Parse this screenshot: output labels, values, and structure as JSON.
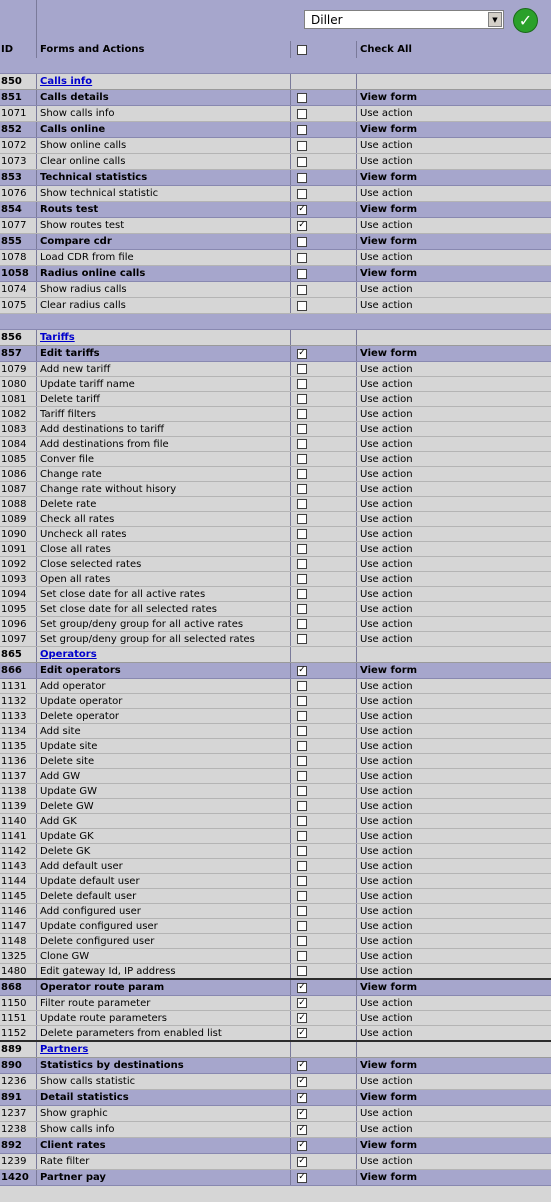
{
  "toolbar": {
    "role_value": "Diller"
  },
  "header": {
    "id_label": "ID",
    "forms_label": "Forms and Actions",
    "check_all_label": "Check All",
    "check_all_checked": false
  },
  "rows": [
    {
      "type": "space",
      "h": 16
    },
    {
      "type": "group",
      "id": "850",
      "name": "Calls info",
      "h": 16
    },
    {
      "type": "form",
      "id": "851",
      "name": "Calls details",
      "checked": false,
      "right": "View form",
      "h": 16
    },
    {
      "type": "action",
      "id": "1071",
      "name": "Show calls info",
      "checked": false,
      "right": "Use action",
      "h": 16
    },
    {
      "type": "form",
      "id": "852",
      "name": "Calls online",
      "checked": false,
      "right": "View form",
      "h": 16
    },
    {
      "type": "action",
      "id": "1072",
      "name": "Show online calls",
      "checked": false,
      "right": "Use action",
      "h": 16
    },
    {
      "type": "action",
      "id": "1073",
      "name": "Clear online calls",
      "checked": false,
      "right": "Use action",
      "h": 16
    },
    {
      "type": "form",
      "id": "853",
      "name": "Technical statistics",
      "checked": false,
      "right": "View form",
      "h": 16
    },
    {
      "type": "action",
      "id": "1076",
      "name": "Show technical statistic",
      "checked": false,
      "right": "Use action",
      "h": 16
    },
    {
      "type": "form",
      "id": "854",
      "name": "Routs test",
      "checked": true,
      "right": "View form",
      "h": 16
    },
    {
      "type": "action",
      "id": "1077",
      "name": "Show routes test",
      "checked": true,
      "right": "Use action",
      "h": 16
    },
    {
      "type": "form",
      "id": "855",
      "name": "Compare cdr",
      "checked": false,
      "right": "View form",
      "h": 16
    },
    {
      "type": "action",
      "id": "1078",
      "name": "Load CDR from file",
      "checked": false,
      "right": "Use action",
      "h": 16
    },
    {
      "type": "form",
      "id": "1058",
      "name": "Radius online calls",
      "checked": false,
      "right": "View form",
      "h": 16
    },
    {
      "type": "action",
      "id": "1074",
      "name": "Show radius calls",
      "checked": false,
      "right": "Use action",
      "h": 16
    },
    {
      "type": "action",
      "id": "1075",
      "name": "Clear radius calls",
      "checked": false,
      "right": "Use action",
      "h": 16
    },
    {
      "type": "space",
      "h": 16
    },
    {
      "type": "group",
      "id": "856",
      "name": "Tariffs",
      "h": 16
    },
    {
      "type": "form",
      "id": "857",
      "name": "Edit tariffs",
      "checked": true,
      "right": "View form",
      "h": 16
    },
    {
      "type": "action",
      "id": "1079",
      "name": "Add new tariff",
      "checked": false,
      "right": "Use action",
      "h": 15
    },
    {
      "type": "action",
      "id": "1080",
      "name": "Update tariff name",
      "checked": false,
      "right": "Use action",
      "h": 15
    },
    {
      "type": "action",
      "id": "1081",
      "name": "Delete tariff",
      "checked": false,
      "right": "Use action",
      "h": 15
    },
    {
      "type": "action",
      "id": "1082",
      "name": "Tariff filters",
      "checked": false,
      "right": "Use action",
      "h": 15
    },
    {
      "type": "action",
      "id": "1083",
      "name": "Add destinations to tariff",
      "checked": false,
      "right": "Use action",
      "h": 15
    },
    {
      "type": "action",
      "id": "1084",
      "name": "Add destinations from file",
      "checked": false,
      "right": "Use action",
      "h": 15
    },
    {
      "type": "action",
      "id": "1085",
      "name": "Conver file",
      "checked": false,
      "right": "Use action",
      "h": 15
    },
    {
      "type": "action",
      "id": "1086",
      "name": "Change rate",
      "checked": false,
      "right": "Use action",
      "h": 15
    },
    {
      "type": "action",
      "id": "1087",
      "name": "Change rate without hisory",
      "checked": false,
      "right": "Use action",
      "h": 15
    },
    {
      "type": "action",
      "id": "1088",
      "name": "Delete rate",
      "checked": false,
      "right": "Use action",
      "h": 15
    },
    {
      "type": "action",
      "id": "1089",
      "name": "Check all rates",
      "checked": false,
      "right": "Use action",
      "h": 15
    },
    {
      "type": "action",
      "id": "1090",
      "name": "Uncheck all rates",
      "checked": false,
      "right": "Use action",
      "h": 15
    },
    {
      "type": "action",
      "id": "1091",
      "name": "Close all rates",
      "checked": false,
      "right": "Use action",
      "h": 15
    },
    {
      "type": "action",
      "id": "1092",
      "name": "Close selected rates",
      "checked": false,
      "right": "Use action",
      "h": 15
    },
    {
      "type": "action",
      "id": "1093",
      "name": "Open all rates",
      "checked": false,
      "right": "Use action",
      "h": 15
    },
    {
      "type": "action",
      "id": "1094",
      "name": "Set close date for all active rates",
      "checked": false,
      "right": "Use action",
      "h": 15
    },
    {
      "type": "action",
      "id": "1095",
      "name": "Set close date for all selected rates",
      "checked": false,
      "right": "Use action",
      "h": 15
    },
    {
      "type": "action",
      "id": "1096",
      "name": "Set group/deny group for all active rates",
      "checked": false,
      "right": "Use action",
      "h": 15
    },
    {
      "type": "action",
      "id": "1097",
      "name": "Set group/deny group for all selected rates",
      "checked": false,
      "right": "Use action",
      "h": 15
    },
    {
      "type": "group",
      "id": "865",
      "name": "Operators",
      "h": 16
    },
    {
      "type": "form",
      "id": "866",
      "name": "Edit operators",
      "checked": true,
      "right": "View form",
      "h": 16
    },
    {
      "type": "action",
      "id": "1131",
      "name": "Add operator",
      "checked": false,
      "right": "Use action",
      "h": 15
    },
    {
      "type": "action",
      "id": "1132",
      "name": "Update operator",
      "checked": false,
      "right": "Use action",
      "h": 15
    },
    {
      "type": "action",
      "id": "1133",
      "name": "Delete operator",
      "checked": false,
      "right": "Use action",
      "h": 15
    },
    {
      "type": "action",
      "id": "1134",
      "name": "Add site",
      "checked": false,
      "right": "Use action",
      "h": 15
    },
    {
      "type": "action",
      "id": "1135",
      "name": "Update site",
      "checked": false,
      "right": "Use action",
      "h": 15
    },
    {
      "type": "action",
      "id": "1136",
      "name": "Delete site",
      "checked": false,
      "right": "Use action",
      "h": 15
    },
    {
      "type": "action",
      "id": "1137",
      "name": "Add GW",
      "checked": false,
      "right": "Use action",
      "h": 15
    },
    {
      "type": "action",
      "id": "1138",
      "name": "Update GW",
      "checked": false,
      "right": "Use action",
      "h": 15
    },
    {
      "type": "action",
      "id": "1139",
      "name": "Delete GW",
      "checked": false,
      "right": "Use action",
      "h": 15
    },
    {
      "type": "action",
      "id": "1140",
      "name": "Add GK",
      "checked": false,
      "right": "Use action",
      "h": 15
    },
    {
      "type": "action",
      "id": "1141",
      "name": "Update GK",
      "checked": false,
      "right": "Use action",
      "h": 15
    },
    {
      "type": "action",
      "id": "1142",
      "name": "Delete GK",
      "checked": false,
      "right": "Use action",
      "h": 15
    },
    {
      "type": "action",
      "id": "1143",
      "name": "Add default user",
      "checked": false,
      "right": "Use action",
      "h": 15
    },
    {
      "type": "action",
      "id": "1144",
      "name": "Update default user",
      "checked": false,
      "right": "Use action",
      "h": 15
    },
    {
      "type": "action",
      "id": "1145",
      "name": "Delete default user",
      "checked": false,
      "right": "Use action",
      "h": 15
    },
    {
      "type": "action",
      "id": "1146",
      "name": "Add configured user",
      "checked": false,
      "right": "Use action",
      "h": 15
    },
    {
      "type": "action",
      "id": "1147",
      "name": "Update configured user",
      "checked": false,
      "right": "Use action",
      "h": 15
    },
    {
      "type": "action",
      "id": "1148",
      "name": "Delete configured user",
      "checked": false,
      "right": "Use action",
      "h": 15
    },
    {
      "type": "action",
      "id": "1325",
      "name": "Clone GW",
      "checked": false,
      "right": "Use action",
      "h": 15
    },
    {
      "type": "action",
      "id": "1480",
      "name": "Edit gateway Id, IP address",
      "checked": false,
      "right": "Use action",
      "h": 15
    },
    {
      "type": "rule"
    },
    {
      "type": "form",
      "id": "868",
      "name": "Operator route param",
      "checked": true,
      "right": "View form",
      "h": 16
    },
    {
      "type": "action",
      "id": "1150",
      "name": "Filter route parameter",
      "checked": true,
      "right": "Use action",
      "h": 15
    },
    {
      "type": "action",
      "id": "1151",
      "name": "Update route parameters",
      "checked": true,
      "right": "Use action",
      "h": 15
    },
    {
      "type": "action",
      "id": "1152",
      "name": "Delete parameters from enabled list",
      "checked": true,
      "right": "Use action",
      "h": 15
    },
    {
      "type": "rule"
    },
    {
      "type": "group",
      "id": "889",
      "name": "Partners",
      "h": 16
    },
    {
      "type": "form",
      "id": "890",
      "name": "Statistics by destinations",
      "checked": true,
      "right": "View form",
      "h": 16
    },
    {
      "type": "action",
      "id": "1236",
      "name": "Show calls statistic",
      "checked": true,
      "right": "Use action",
      "h": 16
    },
    {
      "type": "form",
      "id": "891",
      "name": "Detail statistics",
      "checked": true,
      "right": "View form",
      "h": 16
    },
    {
      "type": "action",
      "id": "1237",
      "name": "Show graphic",
      "checked": true,
      "right": "Use action",
      "h": 16
    },
    {
      "type": "action",
      "id": "1238",
      "name": "Show calls info",
      "checked": true,
      "right": "Use action",
      "h": 16
    },
    {
      "type": "form",
      "id": "892",
      "name": "Client rates",
      "checked": true,
      "right": "View form",
      "h": 16
    },
    {
      "type": "action",
      "id": "1239",
      "name": "Rate filter",
      "checked": true,
      "right": "Use action",
      "h": 16
    },
    {
      "type": "form",
      "id": "1420",
      "name": "Partner pay",
      "checked": true,
      "right": "View form",
      "h": 16
    }
  ]
}
